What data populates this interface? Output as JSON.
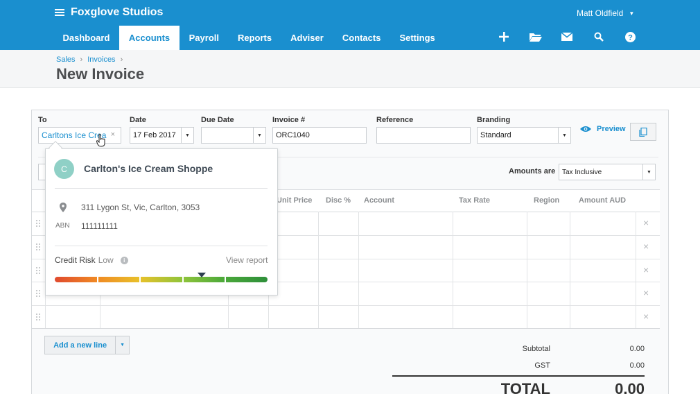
{
  "org": {
    "name": "Foxglove Studios"
  },
  "user": {
    "name": "Matt Oldfield"
  },
  "nav": {
    "items": [
      "Dashboard",
      "Accounts",
      "Payroll",
      "Reports",
      "Adviser",
      "Contacts",
      "Settings"
    ],
    "active": "Accounts",
    "icons": [
      "plus-icon",
      "folder-icon",
      "mail-icon",
      "search-icon",
      "help-icon"
    ]
  },
  "breadcrumb": [
    "Sales",
    "Invoices"
  ],
  "page": {
    "title": "New Invoice"
  },
  "form": {
    "to": {
      "label": "To",
      "value": "Carltons Ice Crea"
    },
    "date": {
      "label": "Date",
      "value": "17 Feb 2017"
    },
    "due_date": {
      "label": "Due Date",
      "value": ""
    },
    "invoice_number": {
      "label": "Invoice #",
      "value": "ORC1040"
    },
    "reference": {
      "label": "Reference",
      "value": ""
    },
    "branding": {
      "label": "Branding",
      "value": "Standard"
    },
    "preview_label": "Preview",
    "amounts_are": {
      "label": "Amounts are",
      "value": "Tax Inclusive"
    }
  },
  "table": {
    "columns": [
      "Unit Price",
      "Disc %",
      "Account",
      "Tax Rate",
      "Region",
      "Amount AUD"
    ],
    "row_count": 5
  },
  "add_line_label": "Add a new line",
  "totals": {
    "subtotal": {
      "label": "Subtotal",
      "value": "0.00"
    },
    "gst": {
      "label": "GST",
      "value": "0.00"
    },
    "total": {
      "label": "TOTAL",
      "value": "0.00"
    }
  },
  "contact_card": {
    "initial": "C",
    "name": "Carlton's Ice Cream Shoppe",
    "address": "311 Lygon St, Vic, Carlton, 3053",
    "abn_label": "ABN",
    "abn": "111111111",
    "credit_risk_label": "Credit Risk",
    "credit_risk_level": "Low",
    "view_report_label": "View report",
    "credit_risk_position": 0.69
  },
  "colors": {
    "brand": "#1a8fcf",
    "avatar": "#8fd0c6"
  }
}
